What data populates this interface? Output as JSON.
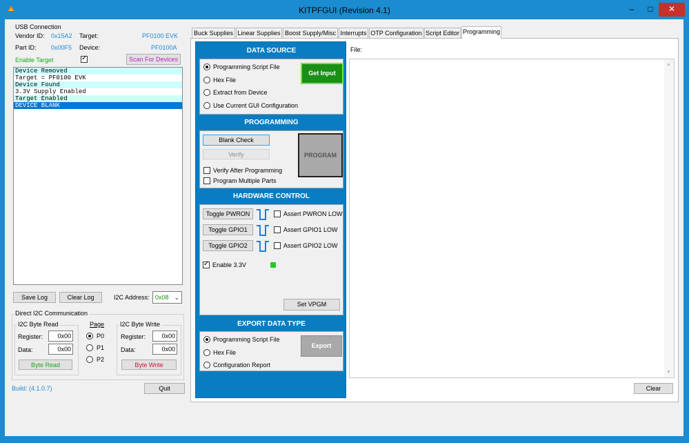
{
  "window": {
    "title": "KITPFGUI (Revision 4.1)",
    "controls": {
      "minimize": "–",
      "maximize": "□",
      "close": "✕"
    }
  },
  "usb": {
    "group_title": "USB Connection",
    "vendor_label": "Vendor ID:",
    "vendor_value": "0x15A2",
    "target_label": "Target:",
    "target_value": "PF0100 EVK",
    "part_label": "Part ID:",
    "part_value": "0x00F5",
    "device_label": "Device:",
    "device_value": "PF0100A",
    "enable_target_label": "Enable Target",
    "enable_target_checked": true,
    "scan_button": "Scan For Devices"
  },
  "log": {
    "rows": [
      {
        "text": "Device Removed",
        "style": "alt"
      },
      {
        "text": "Target = PF0100 EVK",
        "style": ""
      },
      {
        "text": "Device Found",
        "style": "alt"
      },
      {
        "text": "3.3V Supply Enabled",
        "style": ""
      },
      {
        "text": "Target Enabled",
        "style": "alt"
      },
      {
        "text": "DEVICE BLANK",
        "style": "sel"
      }
    ],
    "save_button": "Save Log",
    "clear_button": "Clear Log",
    "i2c_address_label": "I2C Address:",
    "i2c_address_value": "0x08"
  },
  "direct_i2c": {
    "group_title": "Direct I2C Communication",
    "read": {
      "title": "I2C Byte Read",
      "register_label": "Register:",
      "register_value": "0x00",
      "data_label": "Data:",
      "data_value": "0x00",
      "button": "Byte Read"
    },
    "page": {
      "title": "Page",
      "options": [
        "P0",
        "P1",
        "P2"
      ],
      "selected": 0
    },
    "write": {
      "title": "I2C Byte Write",
      "register_label": "Register:",
      "register_value": "0x00",
      "data_label": "Data:",
      "data_value": "0x00",
      "button": "Byte Write"
    }
  },
  "footer": {
    "build": "Build: (4.1.0.7)",
    "quit_button": "Quit"
  },
  "tabs": [
    {
      "label": "Buck Supplies"
    },
    {
      "label": "Linear Supplies"
    },
    {
      "label": "Boost Supply/Misc"
    },
    {
      "label": "Interrupts"
    },
    {
      "label": "OTP Configuration"
    },
    {
      "label": "Script Editor"
    },
    {
      "label": "Programming",
      "active": true
    }
  ],
  "data_source": {
    "title": "DATA SOURCE",
    "options": [
      "Programming Script File",
      "Hex File",
      "Extract from Device",
      "Use Current GUI Configuration"
    ],
    "selected": 0,
    "get_input_button": "Get Input"
  },
  "programming": {
    "title": "PROGRAMMING",
    "blank_check_button": "Blank Check",
    "verify_button": "Verify",
    "program_button": "PROGRAM",
    "verify_after_label": "Verify After Programming",
    "multiple_parts_label": "Program Multiple Parts"
  },
  "hardware": {
    "title": "HARDWARE CONTROL",
    "toggles": [
      {
        "button": "Toggle PWRON",
        "assert": "Assert PWRON LOW"
      },
      {
        "button": "Toggle GPIO1",
        "assert": "Assert GPIO1 LOW"
      },
      {
        "button": "Toggle GPIO2",
        "assert": "Assert GPIO2 LOW"
      }
    ],
    "enable_33_label": "Enable 3.3V",
    "enable_33_checked": true,
    "set_vpgm_button": "Set VPGM",
    "led_color": "#22cc22"
  },
  "export": {
    "title": "EXPORT DATA TYPE",
    "options": [
      "Programming Script File",
      "Hex File",
      "Configuration Report"
    ],
    "selected": 0,
    "export_button": "Export"
  },
  "file": {
    "label": "File:",
    "clear_button": "Clear"
  },
  "colors": {
    "accent_blue": "#0a7dc2",
    "get_input_green": "#1a8f1a",
    "program_gray": "#a9a9a9"
  }
}
